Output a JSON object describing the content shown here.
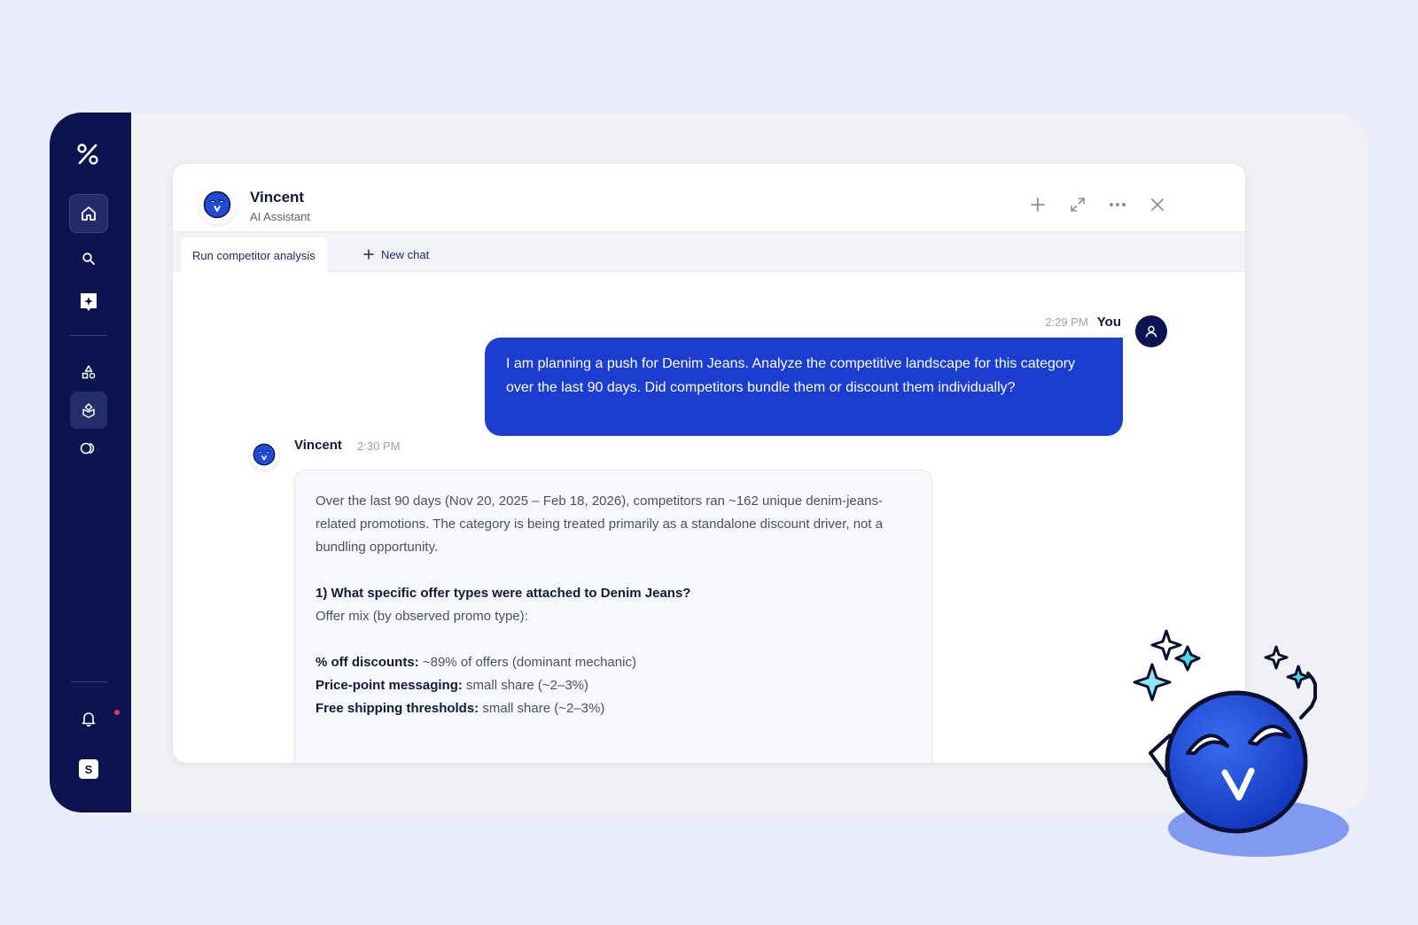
{
  "colors": {
    "background": "#eaecfa",
    "sidebar": "#0c1450",
    "user_bubble": "#1b3ed0",
    "notification_dot": "#f0345c"
  },
  "sidebar": {
    "logo_icon": "percent-icon",
    "items": [
      {
        "icon": "home-icon",
        "state": "selected"
      },
      {
        "icon": "search-icon"
      },
      {
        "icon": "sparkle-icon"
      },
      {
        "icon": "shapes-icon"
      },
      {
        "icon": "box-icon",
        "state": "active"
      },
      {
        "icon": "toggle-icon"
      }
    ],
    "notification_icon": "bell-icon",
    "user_initial": "S"
  },
  "assistant": {
    "name": "Vincent",
    "subtitle": "AI Assistant"
  },
  "header_icons": [
    "plus-icon",
    "expand-icon",
    "more-icon",
    "close-icon"
  ],
  "tabs": {
    "active": "Run competitor analysis",
    "new_chat": "New chat"
  },
  "messages": {
    "user": {
      "author": "You",
      "time": "2:29 PM",
      "text": "I am planning a push for Denim Jeans. Analyze the competitive landscape for this category over the last 90 days. Did competitors bundle them or discount them individually?"
    },
    "bot": {
      "author": "Vincent",
      "time": "2:30 PM",
      "intro": "Over the last 90 days (Nov 20, 2025 – Feb 18, 2026), competitors ran ~162 unique denim-jeans-related promotions. The category is being treated primarily as a standalone discount driver, not a bundling opportunity.",
      "section_heading": "1) What specific offer types were attached to Denim Jeans?",
      "section_sub": "Offer mix (by observed promo type):",
      "offers": [
        {
          "label": "% off discounts:",
          "value": " ~89% of offers (dominant mechanic)"
        },
        {
          "label": "Price-point messaging:",
          "value": " small share (~2–3%)"
        },
        {
          "label": "Free shipping thresholds:",
          "value": " small share (~2–3%)"
        }
      ]
    }
  }
}
